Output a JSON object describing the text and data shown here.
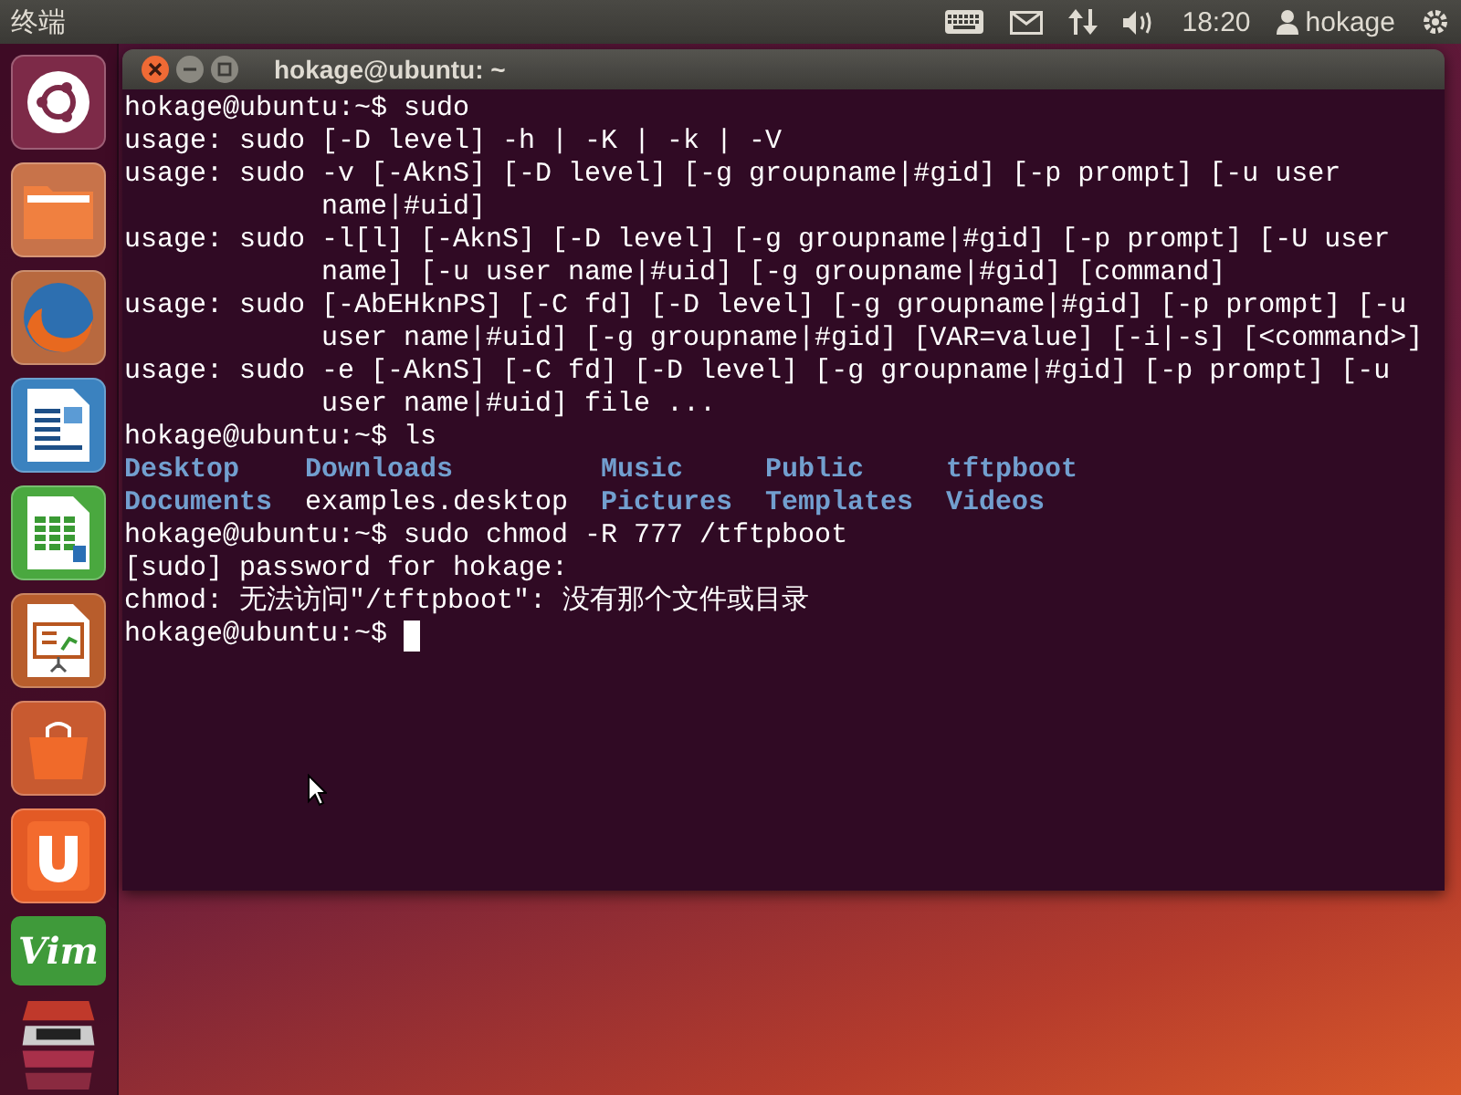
{
  "top_panel": {
    "app_title": "终端",
    "time": "18:20",
    "user": "hokage"
  },
  "launcher": {
    "vim_logo_text": "Vim"
  },
  "terminal": {
    "title": "hokage@ubuntu: ~",
    "lines": [
      {
        "kind": "text",
        "text": "hokage@ubuntu:~$ sudo"
      },
      {
        "kind": "text",
        "text": "usage: sudo [-D level] -h | -K | -k | -V"
      },
      {
        "kind": "text",
        "text": "usage: sudo -v [-AknS] [-D level] [-g groupname|#gid] [-p prompt] [-u user"
      },
      {
        "kind": "continuation",
        "text": "name|#uid]"
      },
      {
        "kind": "text",
        "text": "usage: sudo -l[l] [-AknS] [-D level] [-g groupname|#gid] [-p prompt] [-U user"
      },
      {
        "kind": "continuation",
        "text": "name] [-u user name|#uid] [-g groupname|#gid] [command]"
      },
      {
        "kind": "text",
        "text": "usage: sudo [-AbEHknPS] [-C fd] [-D level] [-g groupname|#gid] [-p prompt] [-u"
      },
      {
        "kind": "continuation",
        "text": "user name|#uid] [-g groupname|#gid] [VAR=value] [-i|-s] [<command>]"
      },
      {
        "kind": "text",
        "text": "usage: sudo -e [-AknS] [-C fd] [-D level] [-g groupname|#gid] [-p prompt] [-u"
      },
      {
        "kind": "continuation",
        "text": "user name|#uid] file ..."
      },
      {
        "kind": "text",
        "text": "hokage@ubuntu:~$ ls"
      },
      {
        "kind": "ls",
        "entries": [
          {
            "name": "Desktop",
            "kind": "dir"
          },
          {
            "name": "Downloads",
            "kind": "dir"
          },
          {
            "name": "Music",
            "kind": "dir"
          },
          {
            "name": "Public",
            "kind": "dir"
          },
          {
            "name": "tftpboot",
            "kind": "dir"
          }
        ]
      },
      {
        "kind": "ls",
        "entries": [
          {
            "name": "Documents",
            "kind": "dir"
          },
          {
            "name": "examples.desktop",
            "kind": "file"
          },
          {
            "name": "Pictures",
            "kind": "dir"
          },
          {
            "name": "Templates",
            "kind": "dir"
          },
          {
            "name": "Videos",
            "kind": "dir"
          }
        ]
      },
      {
        "kind": "text",
        "text": "hokage@ubuntu:~$ sudo chmod -R 777 /tftpboot"
      },
      {
        "kind": "text",
        "text": "[sudo] password for hokage:"
      },
      {
        "kind": "text",
        "text": "chmod: 无法访问\"/tftpboot\": 没有那个文件或目录"
      },
      {
        "kind": "prompt",
        "text": "hokage@ubuntu:~$",
        "cursor": true
      }
    ]
  }
}
